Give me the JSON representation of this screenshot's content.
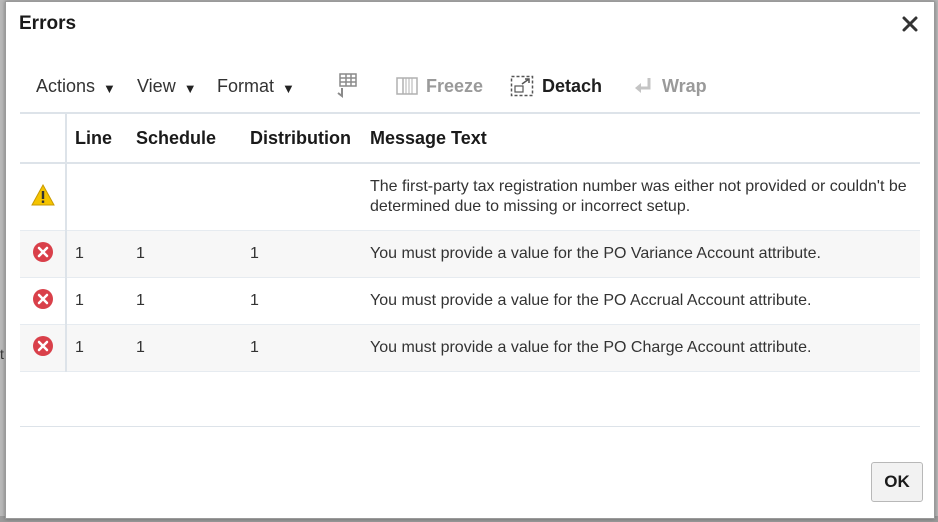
{
  "dialog": {
    "title": "Errors",
    "ok_label": "OK"
  },
  "toolbar": {
    "actions": "Actions",
    "view": "View",
    "format": "Format",
    "freeze": "Freeze",
    "detach": "Detach",
    "wrap": "Wrap"
  },
  "table": {
    "headers": {
      "line": "Line",
      "schedule": "Schedule",
      "distribution": "Distribution",
      "message": "Message Text"
    },
    "rows": [
      {
        "severity": "warning-icon",
        "line": "",
        "schedule": "",
        "distribution": "",
        "message": "The first-party tax registration number was either not provided or couldn't be determined due to missing or incorrect setup."
      },
      {
        "severity": "error-icon",
        "line": "1",
        "schedule": "1",
        "distribution": "1",
        "message": "You must provide a value for the PO Variance Account attribute."
      },
      {
        "severity": "error-icon",
        "line": "1",
        "schedule": "1",
        "distribution": "1",
        "message": "You must provide a value for the PO Accrual Account attribute."
      },
      {
        "severity": "error-icon",
        "line": "1",
        "schedule": "1",
        "distribution": "1",
        "message": "You must provide a value for the PO Charge Account attribute."
      }
    ]
  },
  "background": {
    "fragment": "t"
  },
  "colors": {
    "warning": "#e8b400",
    "error": "#d9404a",
    "border": "#dde3e9"
  }
}
